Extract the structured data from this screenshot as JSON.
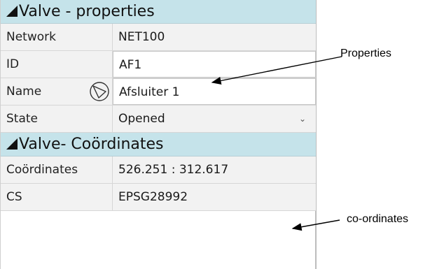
{
  "sections": [
    {
      "title": "Valve - properties",
      "rows": [
        {
          "label": "Network",
          "value": "NET100",
          "kind": "readonly"
        },
        {
          "label": "ID",
          "value": "AF1",
          "kind": "editable"
        },
        {
          "label": "Name",
          "value": "Afsluiter 1",
          "kind": "editable",
          "icon": "valve-icon"
        },
        {
          "label": "State",
          "value": "Opened",
          "kind": "dropdown"
        }
      ]
    },
    {
      "title": "Valve- Coördinates",
      "rows": [
        {
          "label": "Coördinates",
          "value": "526.251 : 312.617",
          "kind": "readonly"
        },
        {
          "label": "CS",
          "value": "EPSG28992",
          "kind": "readonly"
        }
      ]
    }
  ],
  "annotations": {
    "properties": "Properties",
    "coordinates": "co-ordinates"
  },
  "colors": {
    "header_bg": "#c5e3ea",
    "readonly_bg": "#f2f2f2"
  }
}
